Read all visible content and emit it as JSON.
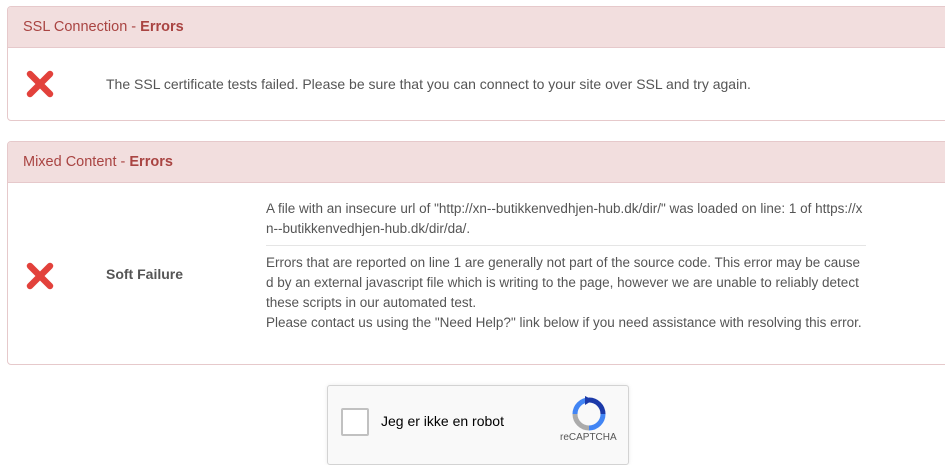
{
  "ssl": {
    "header_title": "SSL Connection",
    "header_sep": " - ",
    "header_status": "Errors",
    "message": "The SSL certificate tests failed. Please be sure that you can connect to your site over SSL and try again."
  },
  "mixed": {
    "header_title": "Mixed Content",
    "header_sep": " - ",
    "header_status": "Errors",
    "result_label": "Soft Failure",
    "detail": "A file with an insecure url of \"http://xn--butikkenvedhjen-hub.dk/dir/\" was loaded on line: 1 of https://xn--butikkenvedhjen-hub.dk/dir/da/.",
    "explanation": "Errors that are reported on line 1 are generally not part of the source code. This error may be caused by an external javascript file which is writing to the page, however we are unable to reliably detect these scripts in our automated test.",
    "contact": "Please contact us using the \"Need Help?\" link below if you need assistance with resolving this error."
  },
  "captcha": {
    "label": "Jeg er ikke en robot",
    "brand": "reCAPTCHA"
  },
  "colors": {
    "header_bg": "#f2dede",
    "header_text": "#a94442",
    "error_icon": "#e2413b"
  },
  "icons": {
    "ssl_status": "error-x-icon",
    "mixed_status": "error-x-icon",
    "captcha_logo": "recaptcha-logo-icon"
  }
}
